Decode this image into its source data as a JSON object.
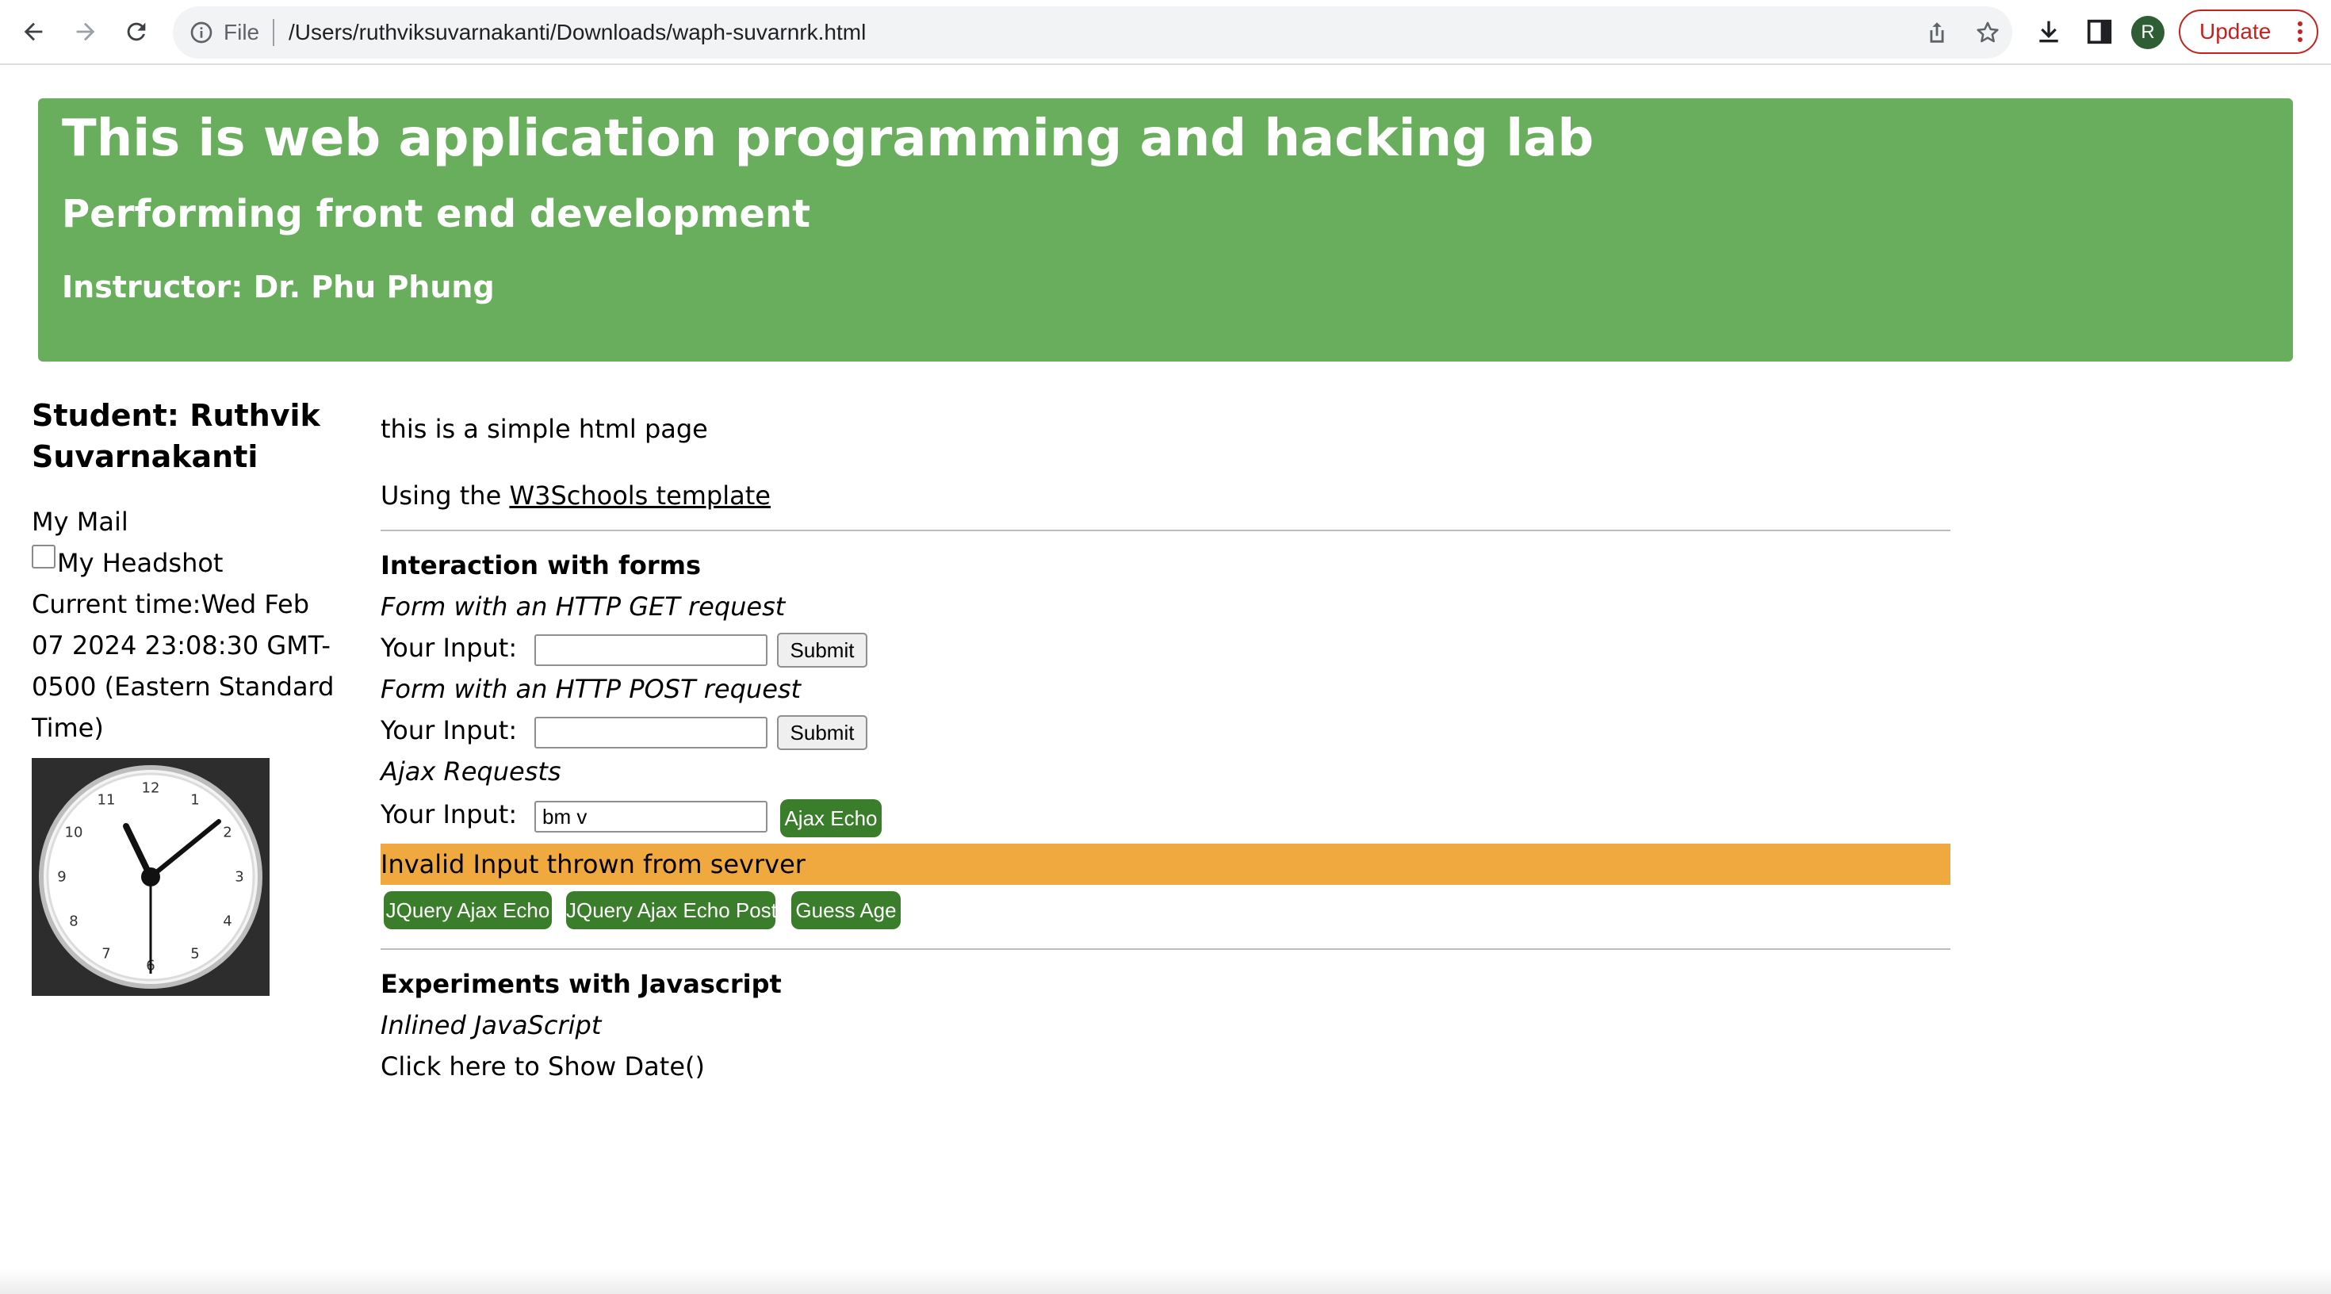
{
  "browser": {
    "file_label": "File",
    "url": "/Users/ruthviksuvarnakanti/Downloads/waph-suvarnrk.html",
    "avatar_letter": "R",
    "update_label": "Update",
    "icons": [
      "back-icon",
      "forward-icon",
      "reload-icon",
      "info-icon",
      "share-icon",
      "star-icon",
      "download-icon",
      "side-panel-icon",
      "more-icon"
    ]
  },
  "header": {
    "title": "This is web application programming and hacking lab",
    "subtitle": "Performing front end development",
    "instructor": "Instructor: Dr. Phu Phung",
    "color": "#69ae5d"
  },
  "sidebar": {
    "student_line1": "Student: Ruthvik",
    "student_line2": "Suvarnakanti",
    "mail": "My Mail",
    "headshot_alt": "My Headshot",
    "time_line1": "Current time:Wed Feb",
    "time_line2": "07 2024 23:08:30 GMT-",
    "time_line3": "0500 (Eastern Standard",
    "time_line4": "Time)",
    "clock_numbers": [
      "12",
      "1",
      "2",
      "3",
      "4",
      "5",
      "6",
      "7",
      "8",
      "9",
      "10",
      "11"
    ]
  },
  "main": {
    "intro": "this is a simple html page",
    "using_prefix": "Using the ",
    "template_link": "W3Schools template",
    "forms_heading": "Interaction with forms",
    "get_label": "Form with an HTTP GET request",
    "input_label": "Your Input:",
    "submit_label": "Submit",
    "post_label": "Form with an HTTP POST request",
    "ajax_label": "Ajax Requests",
    "ajax_input_value": "bm v",
    "ajax_echo_label": "Ajax Echo",
    "alert_text": "Invalid Input thrown from sevrver",
    "alert_color": "#f0a93e",
    "jquery_echo_label": "JQuery Ajax Echo",
    "jquery_post_label": "JQuery Ajax Echo Post",
    "guess_age_label": "Guess Age",
    "js_heading": "Experiments with Javascript",
    "inline_js_label": "Inlined JavaScript",
    "show_date_text": "Click here to Show Date()",
    "button_color": "#3a7d2a"
  }
}
